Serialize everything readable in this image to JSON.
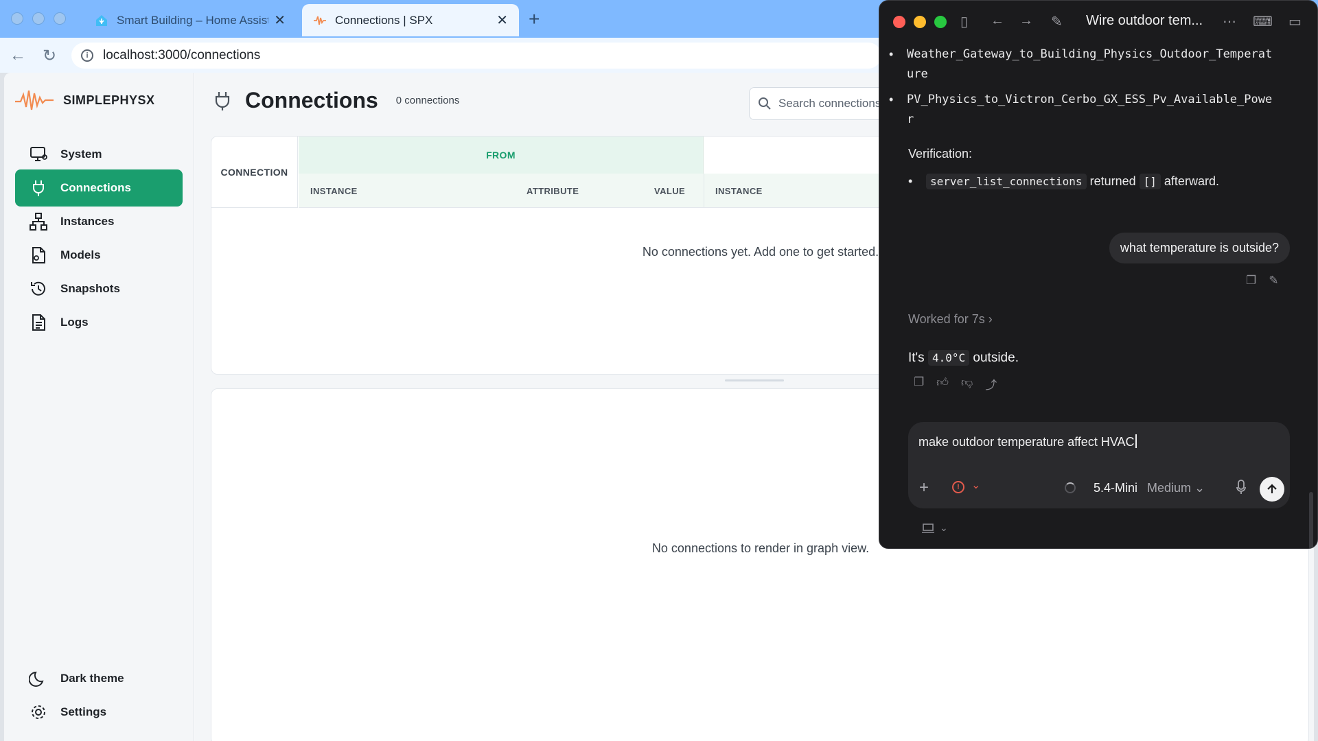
{
  "browser": {
    "tabs": [
      {
        "title": "Smart Building – Home Assistant",
        "active": false
      },
      {
        "title": "Connections | SPX",
        "active": true
      }
    ],
    "url": "localhost:3000/connections"
  },
  "sidebar": {
    "brand": "SIMPLEPHYSX",
    "items": [
      {
        "label": "System",
        "icon": "monitor-icon",
        "active": false
      },
      {
        "label": "Connections",
        "icon": "plug-icon",
        "active": true
      },
      {
        "label": "Instances",
        "icon": "hierarchy-icon",
        "active": false
      },
      {
        "label": "Models",
        "icon": "file-model-icon",
        "active": false
      },
      {
        "label": "Snapshots",
        "icon": "history-icon",
        "active": false
      },
      {
        "label": "Logs",
        "icon": "document-icon",
        "active": false
      }
    ],
    "footer": [
      {
        "label": "Dark theme",
        "icon": "moon-icon"
      },
      {
        "label": "Settings",
        "icon": "gear-icon"
      }
    ]
  },
  "page": {
    "title": "Connections",
    "count": "0 connections",
    "search_placeholder": "Search connections"
  },
  "table": {
    "connection_header": "CONNECTION",
    "from_header": "FROM",
    "columns": [
      "INSTANCE",
      "ATTRIBUTE",
      "VALUE",
      "INSTANCE"
    ],
    "empty": "No connections yet. Add one to get started."
  },
  "graph": {
    "empty": "No connections to render in graph view."
  },
  "chat": {
    "title": "Wire outdoor tem...",
    "bullets": [
      "Weather_Gateway_to_Building_Physics_Outdoor_Temperature",
      "PV_Physics_to_Victron_Cerbo_GX_ESS_Pv_Available_Power"
    ],
    "verification_label": "Verification:",
    "verification": {
      "code1": "server_list_connections",
      "text1": "returned",
      "code2": "[]",
      "text2": "afterward."
    },
    "user_message": "what temperature is outside?",
    "worked": "Worked for 7s",
    "answer": {
      "prefix": "It's",
      "value": "4.0°C",
      "suffix": "outside."
    },
    "composer": {
      "input": "make outdoor temperature affect HVAC",
      "model": "5.4-Mini",
      "effort": "Medium"
    }
  }
}
